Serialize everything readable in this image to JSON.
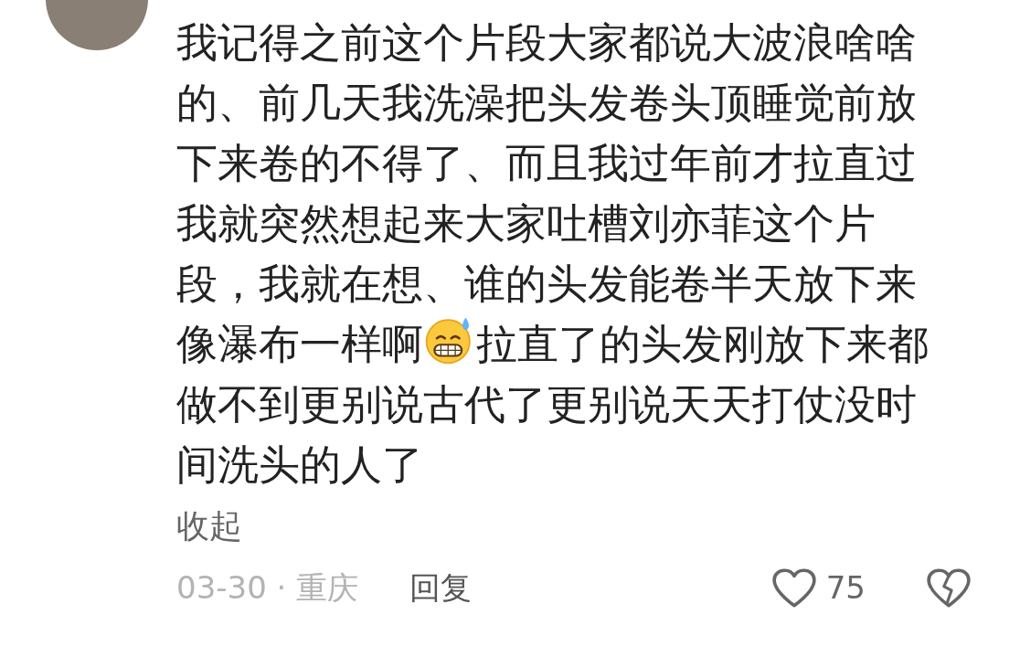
{
  "comment": {
    "text_before_emoji": "我记得之前这个片段大家都说大波浪啥啥的、前几天我洗澡把头发卷头顶睡觉前放下来卷的不得了、而且我过年前才拉直过我就突然想起来大家吐槽刘亦菲这个片段，我就在想、谁的头发能卷半天放下来像瀑布一样啊",
    "text_after_emoji": "拉直了的头发刚放下来都做不到更别说古代了更别说天天打仗没时间洗头的人了",
    "collapse": "收起",
    "meta": "03-30 · 重庆",
    "reply": "回复",
    "likes": "75",
    "liked": false,
    "disliked": false
  }
}
